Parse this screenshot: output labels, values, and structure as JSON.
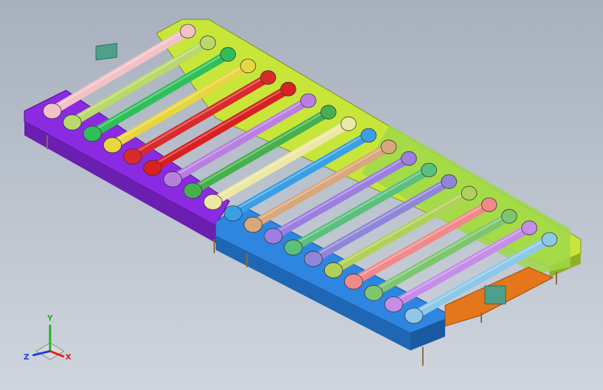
{
  "viewport": {
    "background_top": "#a7b0bd",
    "background_bottom": "#cfd5dd"
  },
  "model": {
    "name": "",
    "plates": [
      {
        "name": "yellow-green-back-plate",
        "color": "#c8e63a"
      },
      {
        "name": "green-side-plate",
        "color": "#9fd84a"
      },
      {
        "name": "purple-left-block",
        "color": "#8a2be2"
      },
      {
        "name": "blue-front-block",
        "color": "#2f86e0"
      },
      {
        "name": "orange-end-block",
        "color": "#e5761a"
      }
    ],
    "tube_colors": [
      "#f3c2c6",
      "#b9d96b",
      "#2fbf5a",
      "#e8d640",
      "#d92b2b",
      "#d82020",
      "#b97fe0",
      "#46b04e",
      "#ede8a6",
      "#3aa0e3",
      "#d8a77c",
      "#9b7fe0",
      "#5ac07b",
      "#8f86d8",
      "#b0d05a",
      "#f08a8a",
      "#7ec66e",
      "#c58de8",
      "#8dc8e8"
    ],
    "row_count": 19
  },
  "triad": {
    "x_label": "X",
    "y_label": "Y",
    "z_label": "Z",
    "x_color": "#e01a1a",
    "y_color": "#1ab21a",
    "z_color": "#1a3ae0"
  }
}
